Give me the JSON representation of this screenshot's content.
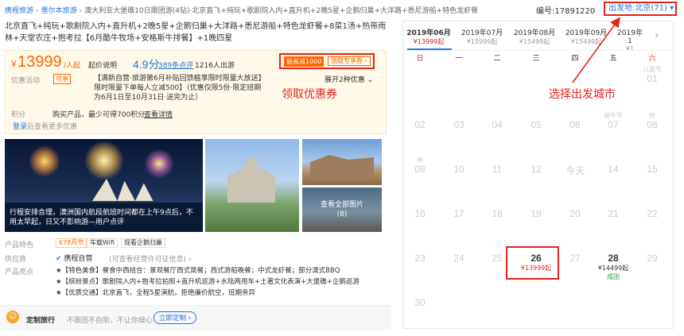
{
  "breadcrumb": [
    "携程旅游",
    "墨尔本旅游",
    "澳大利亚大堡礁10日跟团游(4钻)·北京直飞+纯玩+歌剧院入内+直升机+2晚5星+企鹅归巢+大洋路+悉尼游船+特色龙虾餐"
  ],
  "header": {
    "product_no": "编号:17891220",
    "departure": "出发地:北京(71) ▾"
  },
  "title": "北京直飞+纯玩+歌剧院入内+直升机+2晚5星+企鹅归巢+大洋路+悉尼游船+特色龙虾餐+8菜1汤+热带雨林+天堂农庄+抱考拉【6月酷牛牧场+安格斯牛排餐】+1晚四星",
  "price": {
    "currency": "¥",
    "amount": "13999",
    "unit": "/人起",
    "note": "起价说明",
    "rating": "4.9分",
    "reviews": "389条点评",
    "travelers": "1216人出游"
  },
  "coupon": {
    "max_label": "最高减1000",
    "button": "领取专享券 ›",
    "annotation": "领取优惠券"
  },
  "promo": {
    "label": "优惠活动",
    "tag": "可享",
    "text": "【满新自营·旅游第6月补贴回馈植享限时限量大放送】限时限量下单每人立减500】（优惠仅限5份·限定班期为6月1日至10月31日·送完为止）",
    "expand": "展开2种优惠 ⌄"
  },
  "points": {
    "label": "积分",
    "text": "购买产品，最少可得700积分",
    "link": "查看详情"
  },
  "login": {
    "link": "登录",
    "text": "后查看更多优惠"
  },
  "images": {
    "main_caption": "行程安排合理，澳洲国内航段航班时间都在上午9点后，不用太早起，日又不影响游",
    "main_author": "—用户点评",
    "all_label": "查看全部图片",
    "count": "(8)"
  },
  "features": {
    "label": "产品特色",
    "tags": [
      "678月节",
      "车载Wifi",
      "观看企鹅归巢"
    ]
  },
  "supplier": {
    "label": "供应商",
    "name": "携程自营",
    "note": "(可查看经营许可证信息) ›"
  },
  "highlights": {
    "label": "产品亮点",
    "items": [
      "★【特色美食】餐食中西结合：景观餐厅西式简餐；西式游船晚餐；中式龙虾餐；部分澳式BBQ",
      "★【缤纷景点】歌剧院入内+抱考拉拍照+直升机巡游+水陆两用车+土著文化表演+大堡礁+企鹅巡游",
      "★【优质交通】北京直飞，全程5星演航，拒绝廉价航空，班期务异"
    ]
  },
  "custom": {
    "icon": "☺",
    "title": "定制旅行",
    "sub": "不跟团不自助，不让你操心",
    "button": "立即定制 ›"
  },
  "calendar": {
    "months": [
      {
        "m": "2019年06月",
        "p": "¥13999起"
      },
      {
        "m": "2019年07月",
        "p": "¥15999起"
      },
      {
        "m": "2019年08月",
        "p": "¥15499起"
      },
      {
        "m": "2019年09月",
        "p": "¥15499起"
      },
      {
        "m": "2019年1",
        "p": "¥1"
      }
    ],
    "weekdays": [
      "日",
      "一",
      "二",
      "三",
      "四",
      "五",
      "六"
    ],
    "annotation": "选择出发城市",
    "days": {
      "d01": "01",
      "d01h": "儿童节",
      "d02": "02",
      "d03": "03",
      "d04": "04",
      "d05": "05",
      "d06": "06",
      "d07": "07",
      "d07h": "端午节",
      "d08": "08",
      "d08h": "休",
      "d09": "09",
      "d09h": "休",
      "d10": "10",
      "d11": "11",
      "d12": "12",
      "d13": "今天",
      "d14": "14",
      "d15": "15",
      "d16": "16",
      "d17": "17",
      "d18": "18",
      "d19": "19",
      "d20": "20",
      "d21": "21",
      "d22": "22",
      "d23": "23",
      "d24": "24",
      "d25": "25",
      "d26": "26",
      "d26p": "¥13999起",
      "d27": "27",
      "d28": "28",
      "d28p": "¥14499起",
      "d28s": "成团",
      "d29": "29",
      "d30": "30"
    }
  }
}
